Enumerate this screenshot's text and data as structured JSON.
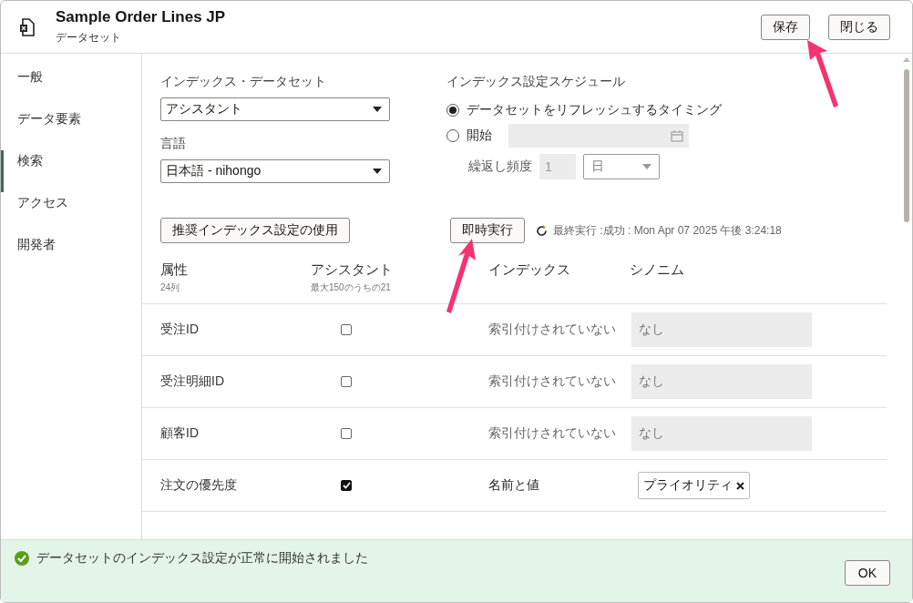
{
  "window": {
    "title": "Sample Order Lines JP",
    "subtitle": "データセット"
  },
  "header_buttons": [
    "保存",
    "閉じる"
  ],
  "sidebar": {
    "items": [
      {
        "label": "一般",
        "selected": false
      },
      {
        "label": "データ要素",
        "selected": false
      },
      {
        "label": "検索",
        "selected": true
      },
      {
        "label": "アクセス",
        "selected": false
      },
      {
        "label": "開発者",
        "selected": false
      }
    ]
  },
  "index_dataset": {
    "label": "インデックス・データセット",
    "value": "アシスタント"
  },
  "language": {
    "label": "言語",
    "value": "日本語 - nihongo"
  },
  "recommend_button": "推奨インデックス設定の使用",
  "schedule": {
    "label": "インデックス設定スケジュール",
    "options": [
      {
        "label": "データセットをリフレッシュするタイミング",
        "selected": true
      },
      {
        "label": "開始",
        "selected": false
      }
    ],
    "repeat_label": "繰返し頻度",
    "repeat_value": "1",
    "repeat_unit": "日"
  },
  "run_button": "即時実行",
  "last_run": "最終実行 :成功 : Mon Apr 07 2025 午後 3:24:18",
  "table": {
    "columns": [
      {
        "label": "属性",
        "sub": "24列"
      },
      {
        "label": "アシスタント",
        "sub": "最大150のうちの21"
      },
      {
        "label": "インデックス"
      },
      {
        "label": "シノニム"
      }
    ],
    "rows": [
      {
        "attribute": "受注ID",
        "checked": false,
        "index": "索引付けされていない",
        "indexed": false,
        "placeholder": "なし"
      },
      {
        "attribute": "受注明細ID",
        "checked": false,
        "index": "索引付けされていない",
        "indexed": false,
        "placeholder": "なし"
      },
      {
        "attribute": "顧客ID",
        "checked": false,
        "index": "索引付けされていない",
        "indexed": false,
        "placeholder": "なし"
      },
      {
        "attribute": "注文の優先度",
        "checked": true,
        "index": "名前と値",
        "indexed": true,
        "synonyms": [
          "プライオリティ"
        ]
      }
    ]
  },
  "toast": {
    "message": "データセットのインデックス設定が正常に開始されました",
    "button": "OK"
  }
}
